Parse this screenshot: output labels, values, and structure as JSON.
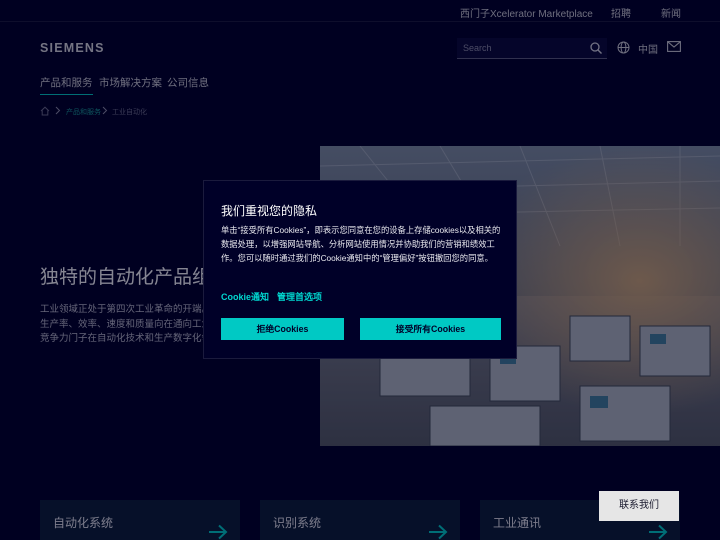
{
  "topbar": {
    "marketplace": "西门子Xcelerator Marketplace",
    "jobs": "招聘",
    "news": "新闻"
  },
  "header": {
    "logo": "SIEMENS",
    "search_placeholder": "Search",
    "language": "中国",
    "icons": [
      "search-icon",
      "globe-icon",
      "mail-icon"
    ]
  },
  "nav": {
    "items": [
      {
        "label": "产品和服务",
        "active": true
      },
      {
        "label": "市场解决方案",
        "active": false
      },
      {
        "label": "公司信息",
        "active": false
      }
    ]
  },
  "breadcrumb": {
    "items": [
      "产品和服务",
      "工业自动化"
    ]
  },
  "hero": {
    "title": "独特的自动化产品组",
    "body": "工业领域正处于第四次工业革命的开端。推动的数字化。目标是生产率、效率、速度和质量向在通向工业未来的道路上获得更高竞争力门子在自动化技术和生产数字化领域中的领先"
  },
  "cards": [
    {
      "label": "自动化系统"
    },
    {
      "label": "识别系统"
    },
    {
      "label": "工业通讯"
    }
  ],
  "cookie_dialog": {
    "title": "我们重视您的隐私",
    "body": "单击“接受所有Cookies”，即表示您同意在您的设备上存储cookies以及相关的数据处理，以增强网站导航、分析网站使用情况并协助我们的营销和绩效工作。您可以随时通过我们的Cookie通知中的“管理偏好”按钮撤回您的同意。",
    "link_notice": "Cookie通知",
    "link_manage": "管理首选项",
    "reject_label": "拒绝Cookies",
    "accept_label": "接受所有Cookies"
  },
  "contact_button": "联系我们",
  "colors": {
    "background": "#000028",
    "accent": "#00c9c4",
    "card": "#0b1e37"
  }
}
